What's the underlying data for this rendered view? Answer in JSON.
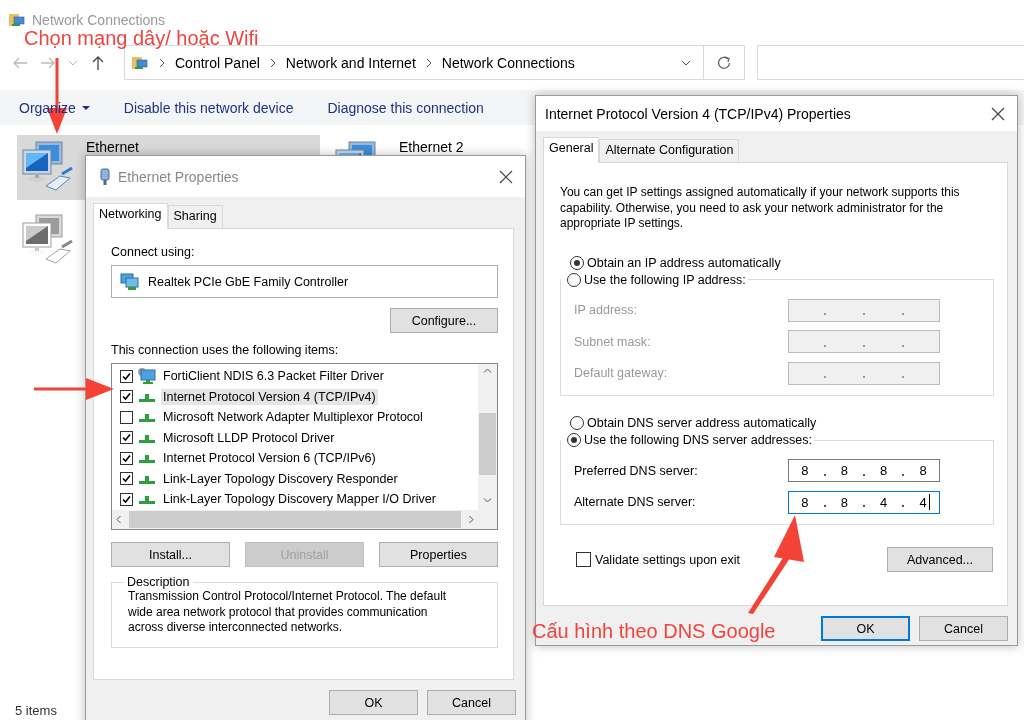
{
  "explorer": {
    "title": "Network Connections",
    "breadcrumb": [
      "Control Panel",
      "Network and Internet",
      "Network Connections"
    ],
    "commands": [
      {
        "label": "Organize",
        "kind": "menu"
      },
      {
        "label": "Disable this network device",
        "kind": "plain"
      },
      {
        "label": "Diagnose this connection",
        "kind": "plain"
      }
    ],
    "connections": [
      {
        "name": "Ethernet",
        "selected": true,
        "disabled": false
      },
      {
        "name": "Ethernet 2",
        "selected": false,
        "disabled": false
      },
      {
        "selected": false,
        "disabled": true
      }
    ],
    "status": "5 items"
  },
  "ethernet_dialog": {
    "title": "Ethernet Properties",
    "tabs": [
      {
        "label": "Networking",
        "selected": true
      },
      {
        "label": "Sharing",
        "selected": false
      }
    ],
    "connect_using_label": "Connect using:",
    "adapter": "Realtek PCIe GbE Family Controller",
    "configure_button": "Configure...",
    "items_label": "This connection uses the following items:",
    "items": [
      {
        "label": "FortiClient NDIS 6.3 Packet Filter Driver",
        "checked": true,
        "selected": false,
        "kind": "filter"
      },
      {
        "label": "Internet Protocol Version 4 (TCP/IPv4)",
        "checked": true,
        "selected": true,
        "kind": "protocol"
      },
      {
        "label": "Microsoft Network Adapter Multiplexor Protocol",
        "checked": false,
        "selected": false,
        "kind": "protocol"
      },
      {
        "label": "Microsoft LLDP Protocol Driver",
        "checked": true,
        "selected": false,
        "kind": "protocol"
      },
      {
        "label": "Internet Protocol Version 6 (TCP/IPv6)",
        "checked": true,
        "selected": false,
        "kind": "protocol"
      },
      {
        "label": "Link-Layer Topology Discovery Responder",
        "checked": true,
        "selected": false,
        "kind": "protocol"
      },
      {
        "label": "Link-Layer Topology Discovery Mapper I/O Driver",
        "checked": true,
        "selected": false,
        "kind": "protocol"
      }
    ],
    "item_buttons": [
      {
        "label": "Install...",
        "disabled": false
      },
      {
        "label": "Uninstall",
        "disabled": true
      },
      {
        "label": "Properties",
        "disabled": false
      }
    ],
    "description_label": "Description",
    "description": "Transmission Control Protocol/Internet Protocol. The default wide area network protocol that provides communication across diverse interconnected networks.",
    "footer_buttons": [
      {
        "label": "OK",
        "focused": false
      },
      {
        "label": "Cancel",
        "focused": false
      }
    ]
  },
  "ipv4_dialog": {
    "title": "Internet Protocol Version 4 (TCP/IPv4) Properties",
    "tabs": [
      {
        "label": "General",
        "selected": true
      },
      {
        "label": "Alternate Configuration",
        "selected": false
      }
    ],
    "intro": "You can get IP settings assigned automatically if your network supports this capability. Otherwise, you need to ask your network administrator for the appropriate IP settings.",
    "ip_options": [
      {
        "label": "Obtain an IP address automatically",
        "selected": true
      },
      {
        "label": "Use the following IP address:",
        "selected": false
      }
    ],
    "ip_fields": [
      {
        "label": "IP address:",
        "disabled": true,
        "focused": false
      },
      {
        "label": "Subnet mask:",
        "disabled": true,
        "focused": false
      },
      {
        "label": "Default gateway:",
        "disabled": true,
        "focused": false
      }
    ],
    "dns_options": [
      {
        "label": "Obtain DNS server address automatically",
        "selected": false
      },
      {
        "label": "Use the following DNS server addresses:",
        "selected": true
      }
    ],
    "dns_fields": [
      {
        "label": "Preferred DNS server:",
        "disabled": false,
        "focused": false,
        "octets": [
          "8",
          "8",
          "8",
          "8"
        ]
      },
      {
        "label": "Alternate DNS server:",
        "disabled": false,
        "focused": true,
        "octets": [
          "8",
          "8",
          "4",
          "4"
        ]
      }
    ],
    "validate": {
      "label": "Validate settings upon exit",
      "checked": false
    },
    "advanced_button": "Advanced...",
    "footer_buttons": [
      {
        "label": "OK",
        "focused": true
      },
      {
        "label": "Cancel",
        "focused": false
      }
    ]
  },
  "annotations": [
    {
      "text": "Chọn mạng dây/ hoặc Wifi"
    },
    {
      "text": "Cấu hình theo DNS Google"
    }
  ]
}
